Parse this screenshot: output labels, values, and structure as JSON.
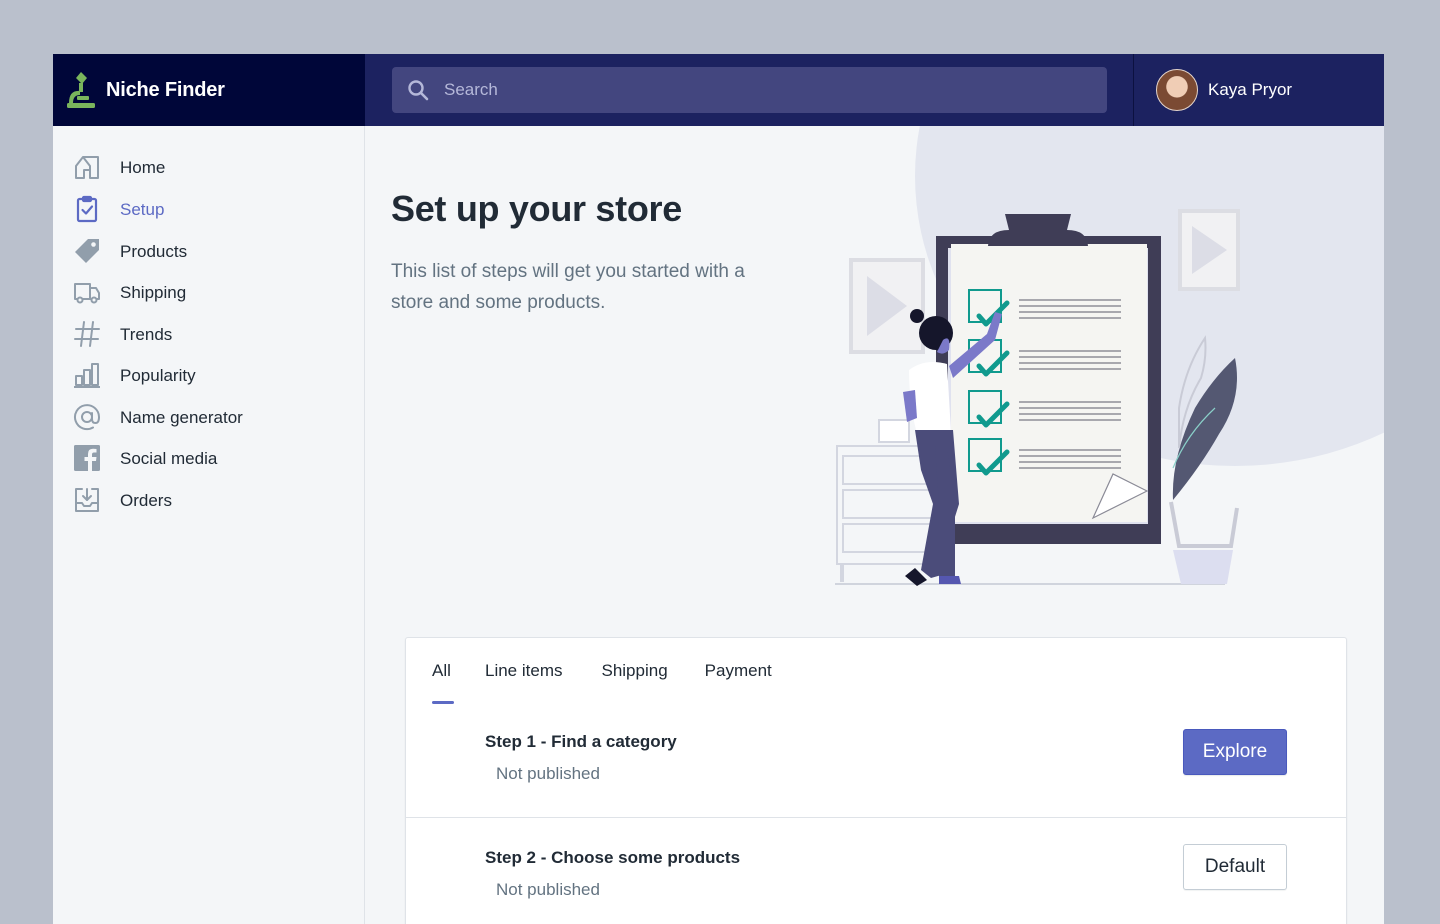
{
  "app": {
    "name": "Niche Finder"
  },
  "search": {
    "placeholder": "Search"
  },
  "user": {
    "name": "Kaya Pryor"
  },
  "sidebar": {
    "items": [
      {
        "label": "Home",
        "icon": "home-icon"
      },
      {
        "label": "Setup",
        "icon": "clipboard-check-icon",
        "active": true
      },
      {
        "label": "Products",
        "icon": "tag-icon"
      },
      {
        "label": "Shipping",
        "icon": "truck-icon"
      },
      {
        "label": "Trends",
        "icon": "hashtag-icon"
      },
      {
        "label": "Popularity",
        "icon": "bar-chart-icon"
      },
      {
        "label": "Name generator",
        "icon": "at-sign-icon"
      },
      {
        "label": "Social media",
        "icon": "facebook-icon"
      },
      {
        "label": "Orders",
        "icon": "inbox-download-icon"
      }
    ]
  },
  "page": {
    "title": "Set up your store",
    "subtitle": "This list of steps will get you started with a store and some products."
  },
  "tabs": [
    {
      "label": "All",
      "active": true
    },
    {
      "label": "Line items"
    },
    {
      "label": "Shipping"
    },
    {
      "label": "Payment"
    }
  ],
  "steps": [
    {
      "title": "Step 1 - Find a category",
      "status": "Not published",
      "button": "Explore",
      "button_style": "primary"
    },
    {
      "title": "Step 2 - Choose some products",
      "status": "Not published",
      "button": "Default",
      "button_style": "secondary"
    }
  ],
  "colors": {
    "top_bar": "#1c2260",
    "brand_bar": "#000639",
    "accent": "#5c6ac4",
    "logo_green": "#7ab55c",
    "checkmark_teal": "#109a8e"
  }
}
